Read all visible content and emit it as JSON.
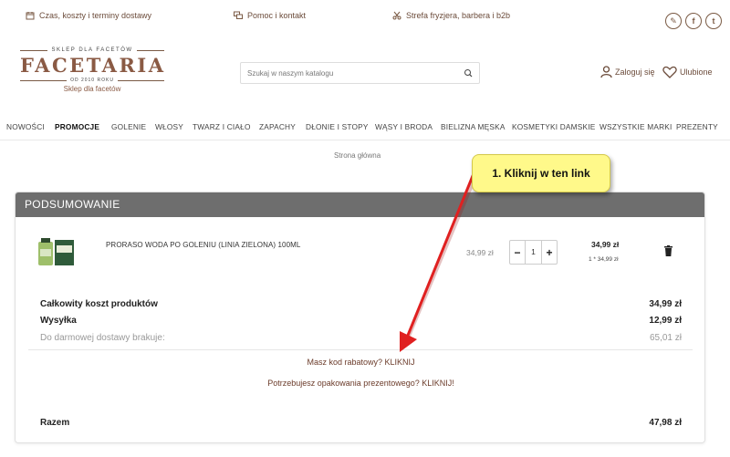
{
  "topbar": {
    "delivery": "Czas, koszty i terminy dostawy",
    "help": "Pomoc i kontakt",
    "zone": "Strefa fryzjera, barbera i b2b"
  },
  "logo": {
    "tagline_top": "SKLEP DLA FACETÓW",
    "brand": "FACETARIA",
    "since": "OD 2010 ROKU",
    "tagline_bottom": "Sklep dla facetów"
  },
  "search": {
    "placeholder": "Szukaj w naszym katalogu"
  },
  "account": {
    "login": "Zaloguj się",
    "favorites": "Ulubione"
  },
  "nav": [
    "NOWOŚCI",
    "PROMOCJE",
    "GOLENIE",
    "WŁOSY",
    "TWARZ I CIAŁO",
    "ZAPACHY",
    "DŁONIE I STOPY",
    "WĄSY I BRODA",
    "BIELIZNA MĘSKA",
    "KOSMETYKI DAMSKIE",
    "WSZYSTKIE MARKI",
    "PREZENTY"
  ],
  "breadcrumb": "Strona główna",
  "summary": {
    "title": "PODSUMOWANIE",
    "product": {
      "name": "PRORASO WODA PO GOLENIU (LINIA ZIELONA) 100ML",
      "unit_price": "34,99 zł",
      "quantity": "1",
      "total": "34,99 zł",
      "calc": "1 * 34,99 zł"
    },
    "products_cost_label": "Całkowity koszt produktów",
    "products_cost": "34,99 zł",
    "shipping_label": "Wysyłka",
    "shipping": "12,99 zł",
    "free_shipping_label": "Do darmowej dostawy brakuje:",
    "free_shipping": "65,01 zł",
    "discount_link": "Masz kod rabatowy? KLIKNIJ",
    "gift_link": "Potrzebujesz opakowania prezentowego? KLIKNIJ!",
    "total_label": "Razem",
    "total": "47,98 zł"
  },
  "annotation": {
    "text": "1. Kliknij w ten link"
  },
  "colors": {
    "brand": "#8a5a44",
    "header": "#6e6e6e",
    "callout": "#fff98a",
    "arrow": "#e02020"
  }
}
